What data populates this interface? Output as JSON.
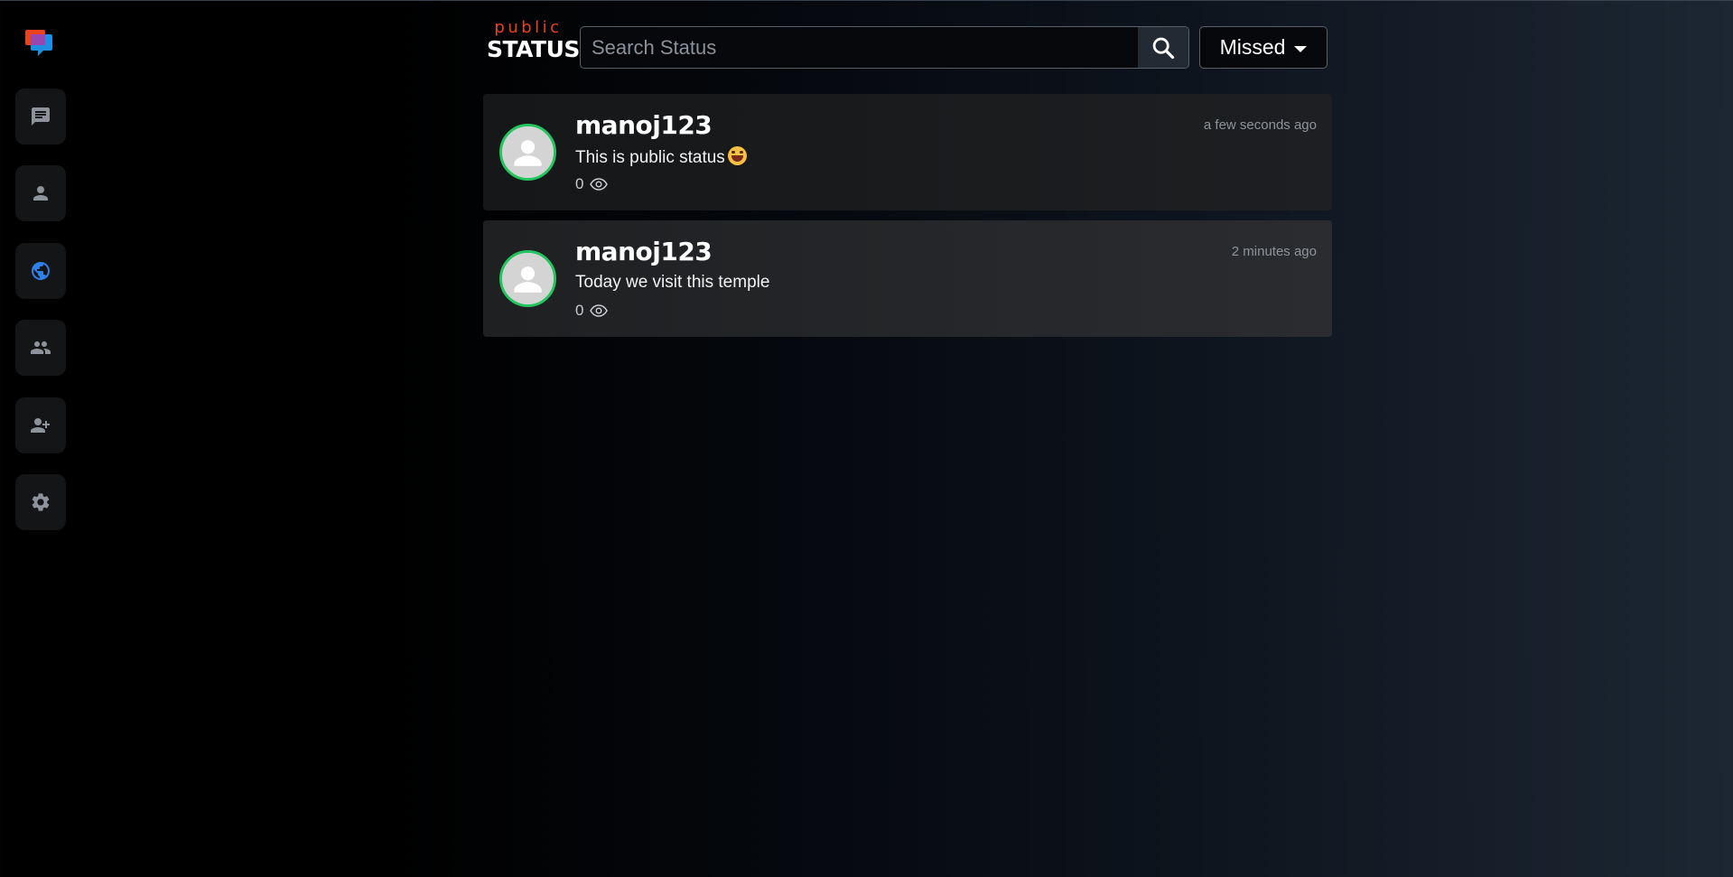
{
  "app": {
    "logo_icon": "chat-bubbles-logo-icon",
    "accent_color": "#e8431c",
    "active_color": "#2f7fe6",
    "online_ring_color": "#22c55e"
  },
  "sidebar": {
    "items": [
      {
        "name": "chats",
        "icon": "message-icon",
        "active": false
      },
      {
        "name": "profile",
        "icon": "person-icon",
        "active": false
      },
      {
        "name": "public-status",
        "icon": "globe-icon",
        "active": true
      },
      {
        "name": "groups",
        "icon": "people-icon",
        "active": false
      },
      {
        "name": "add-friend",
        "icon": "person-add-icon",
        "active": false
      },
      {
        "name": "settings",
        "icon": "gear-icon",
        "active": false
      }
    ]
  },
  "header": {
    "brand_small": "public",
    "brand_big": "STATUS",
    "search_placeholder": "Search Status",
    "search_value": "",
    "search_icon": "search-icon",
    "filter_label": "Missed",
    "filter_icon": "caret-down-icon"
  },
  "statuses": [
    {
      "username": "manoj123",
      "text": "This is public status",
      "emoji": "grinning-face-emoji",
      "views": "0",
      "time": "a few seconds ago"
    },
    {
      "username": "manoj123",
      "text": "Today we visit this temple",
      "views": "0",
      "time": "2 minutes ago"
    }
  ]
}
